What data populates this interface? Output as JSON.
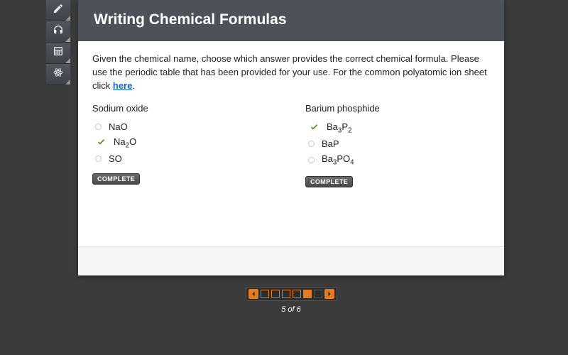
{
  "title": "Writing Chemical Formulas",
  "instructions": {
    "text_before": "Given the chemical name, choose which answer provides the correct chemical formula. Please use the periodic table that has been provided for your use. For the common polyatomic ion sheet click ",
    "link_text": "here",
    "text_after": "."
  },
  "questions": [
    {
      "prompt": "Sodium oxide",
      "options": [
        {
          "html": "NaO",
          "selected": false
        },
        {
          "html": "Na<sub>2</sub>O",
          "selected": true
        },
        {
          "html": "SO",
          "selected": false
        }
      ],
      "status": "COMPLETE"
    },
    {
      "prompt": "Barium phosphide",
      "options": [
        {
          "html": "Ba<sub>3</sub>P<sub>2</sub>",
          "selected": true
        },
        {
          "html": "BaP",
          "selected": false
        },
        {
          "html": "Ba<sub>3</sub>PO<sub>4</sub>",
          "selected": false
        }
      ],
      "status": "COMPLETE"
    }
  ],
  "pager": {
    "current": 5,
    "total": 6,
    "label": "5 of 6"
  },
  "toolstrip": [
    {
      "name": "pencil-icon"
    },
    {
      "name": "headphones-icon"
    },
    {
      "name": "calculator-icon"
    },
    {
      "name": "atom-icon"
    }
  ]
}
